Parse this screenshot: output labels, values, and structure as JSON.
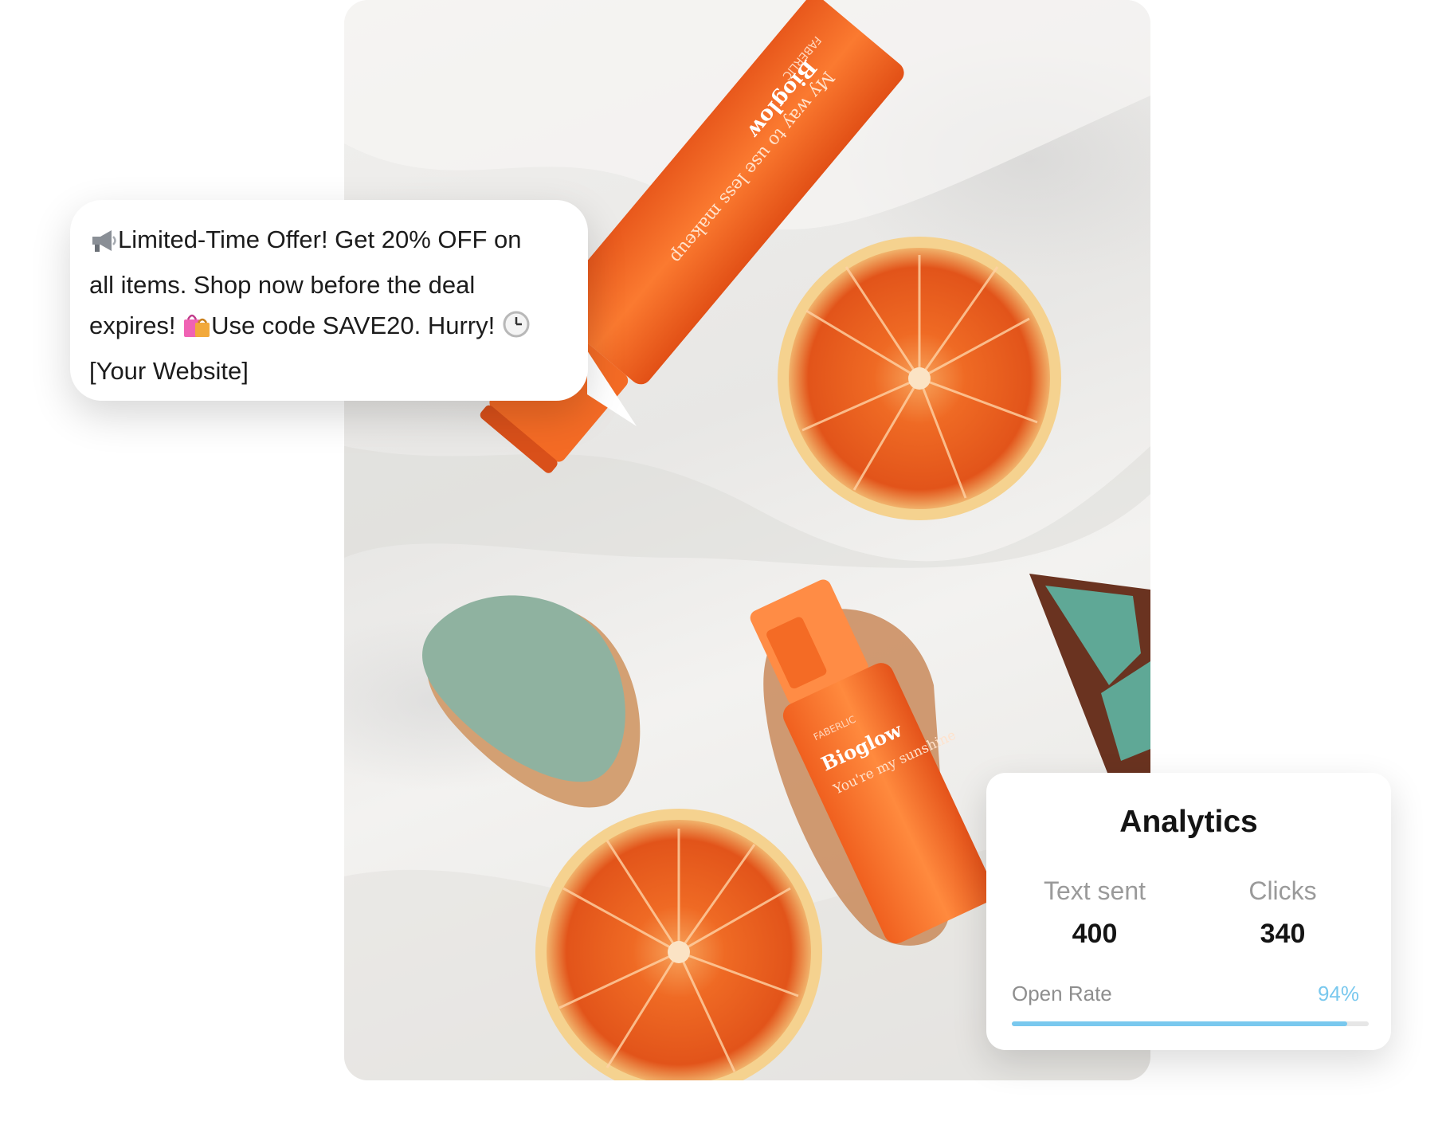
{
  "image": {
    "photo_alt": "Orange Bioglow skincare tubes and halved oranges on white fabric",
    "tube_main_brand": "FABERLIC",
    "tube_main_name": "Bioglow",
    "tube_main_tagline": "My way to use less makeup",
    "tube_small_brand": "FABERLIC",
    "tube_small_name": "Bioglow",
    "tube_small_tagline": "You're my sunshine"
  },
  "message": {
    "megaphone_icon": "megaphone-icon",
    "lines": [
      "Limited-Time Offer! Get 20% OFF on",
      "all items. Shop now before the deal",
      "expires!",
      "Use code SAVE20. Hurry!",
      "[Your Website]"
    ],
    "shopping_bags_icon": "shopping-bags-icon",
    "clock_icon": "clock-icon"
  },
  "analytics": {
    "title": "Analytics",
    "text_sent_label": "Text sent",
    "text_sent_value": "400",
    "clicks_label": "Clicks",
    "clicks_value": "340",
    "open_rate_label": "Open Rate",
    "open_rate_value": "94%",
    "open_rate_fraction": 0.94,
    "accent_color": "#79c8ee"
  }
}
